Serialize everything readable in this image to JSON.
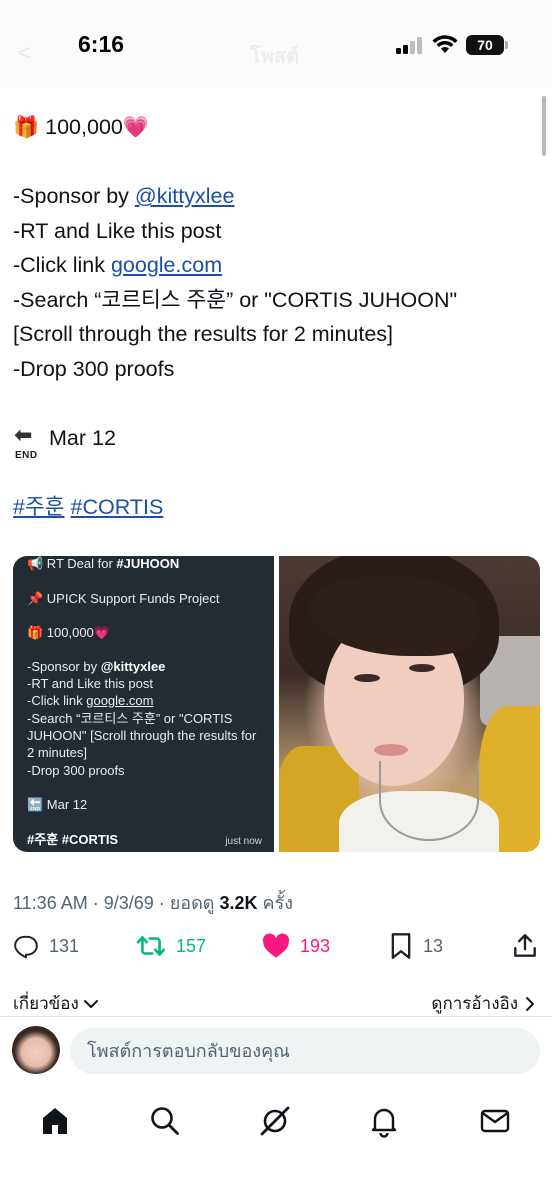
{
  "status_bar": {
    "time": "6:16",
    "battery": "70",
    "back_ghost": "<",
    "title_ghost": "โพสต์"
  },
  "tweet": {
    "lines": {
      "prize_emoji": "🎁",
      "prize": "100,000",
      "heart_emoji": "💗",
      "sponsor_prefix": "-Sponsor by ",
      "sponsor_handle": "@kittyxlee",
      "rt_like": "-RT and Like this post",
      "click_prefix": "-Click link ",
      "click_link": "google.com",
      "search": "-Search “코르티스 주훈” or \"CORTIS JUHOON\"",
      "scroll": "[Scroll through the results for 2 minutes]",
      "drop": "-Drop 300 proofs",
      "end_label": "END",
      "end_date": "Mar 12",
      "hashtag1": "#주훈",
      "hashtag2": "#CORTIS"
    }
  },
  "media": {
    "card": {
      "deal_prefix": "📢 RT Deal for ",
      "deal_tag": "#JUHOON",
      "project": "📌 UPICK Support Funds Project",
      "prize": "🎁 100,000💗",
      "sponsor_prefix": "-Sponsor by ",
      "sponsor_handle": "@kittyxlee",
      "rt_like": "-RT and Like this post",
      "click_prefix": "-Click link ",
      "click_link": "google.com",
      "search1": "-Search “코르티스 주훈” or \"CORTIS",
      "search2": "JUHOON\" [Scroll through the results for",
      "search3": "2 minutes]",
      "drop": "-Drop 300 proofs",
      "end_date": "🔚 Mar 12",
      "hashtags": "#주훈 #CORTIS",
      "timestamp": "just now"
    }
  },
  "meta": {
    "time_date": "11:36 AM · 9/3/69 · ยอดดู ",
    "views": "3.2K",
    "views_suffix": " ครั้ง"
  },
  "actions": {
    "replies": "131",
    "reposts": "157",
    "likes": "193",
    "bookmarks": "13"
  },
  "related": {
    "label": "เกี่ยวข้อง",
    "quotes_label": "ดูการอ้างอิง"
  },
  "reply": {
    "placeholder": "โพสต์การตอบกลับของคุณ"
  },
  "colors": {
    "link": "#1d4fa8",
    "repost_green": "#00ba7c",
    "like_pink": "#f91880",
    "muted": "#536471"
  },
  "icons": {
    "tabbar": [
      "home-icon",
      "search-icon",
      "grok-icon",
      "notifications-icon",
      "messages-icon"
    ]
  }
}
